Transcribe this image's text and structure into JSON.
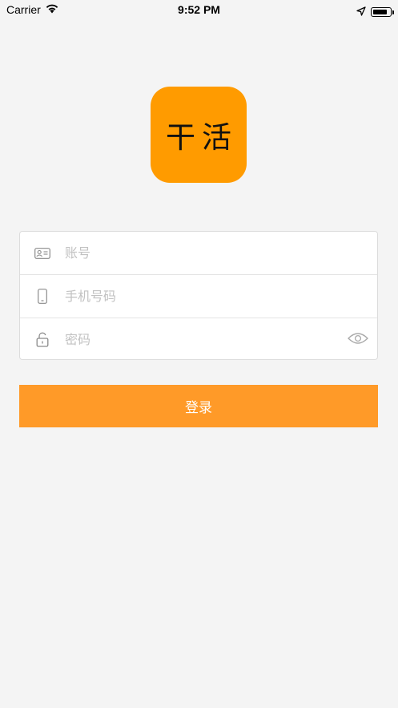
{
  "status_bar": {
    "carrier": "Carrier",
    "time": "9:52 PM",
    "battery_level": 0.85
  },
  "logo": {
    "text": "干活",
    "background_color": "#ff9b00"
  },
  "form": {
    "account": {
      "value": "",
      "placeholder": "账号",
      "icon": "id-card-icon"
    },
    "phone": {
      "value": "",
      "placeholder": "手机号码",
      "icon": "phone-icon"
    },
    "password": {
      "value": "",
      "placeholder": "密码",
      "icon": "lock-icon",
      "toggle_icon": "eye-icon"
    }
  },
  "login_button": {
    "label": "登录",
    "color": "#ff9a28"
  }
}
